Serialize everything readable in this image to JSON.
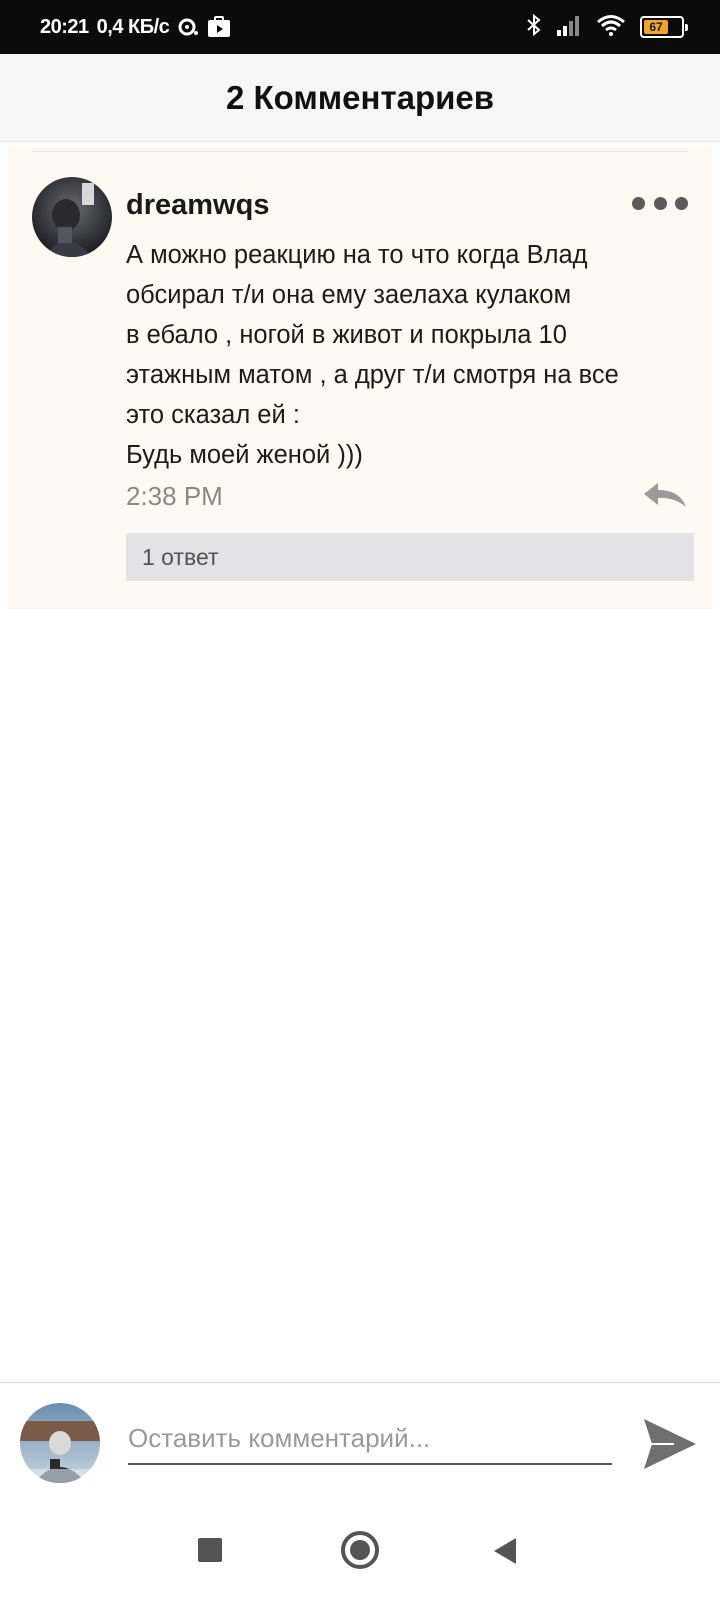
{
  "status_bar": {
    "time": "20:21",
    "speed": "0,4 КБ/с",
    "battery": "67",
    "battery_level": 0.67,
    "icons": [
      "sync-icon",
      "youtube-icon",
      "bluetooth-icon",
      "signal-icon",
      "wifi-icon",
      "battery-icon"
    ]
  },
  "header": {
    "title": "2 Комментариев"
  },
  "comment": {
    "username": "dreamwqs",
    "text_lines": [
      "А можно реакцию на то что когда Влад",
      "обсирал т/и она ему заелаха кулаком",
      "в ебало , ногой в живот и покрыла 10",
      "этажным матом , а друг т/и смотря на все",
      "это сказал ей :",
      "Будь моей женой )))"
    ],
    "time": "2:38 PM",
    "replies_label": "1 ответ"
  },
  "input": {
    "placeholder": "Оставить комментарий..."
  },
  "colors": {
    "card_bg": "#fff9f3",
    "status_bar_bg": "#0b0b0b",
    "header_bg": "#f6f6f7",
    "replies_bg": "#e3e3e5",
    "battery_fill": "#f0a52a"
  }
}
